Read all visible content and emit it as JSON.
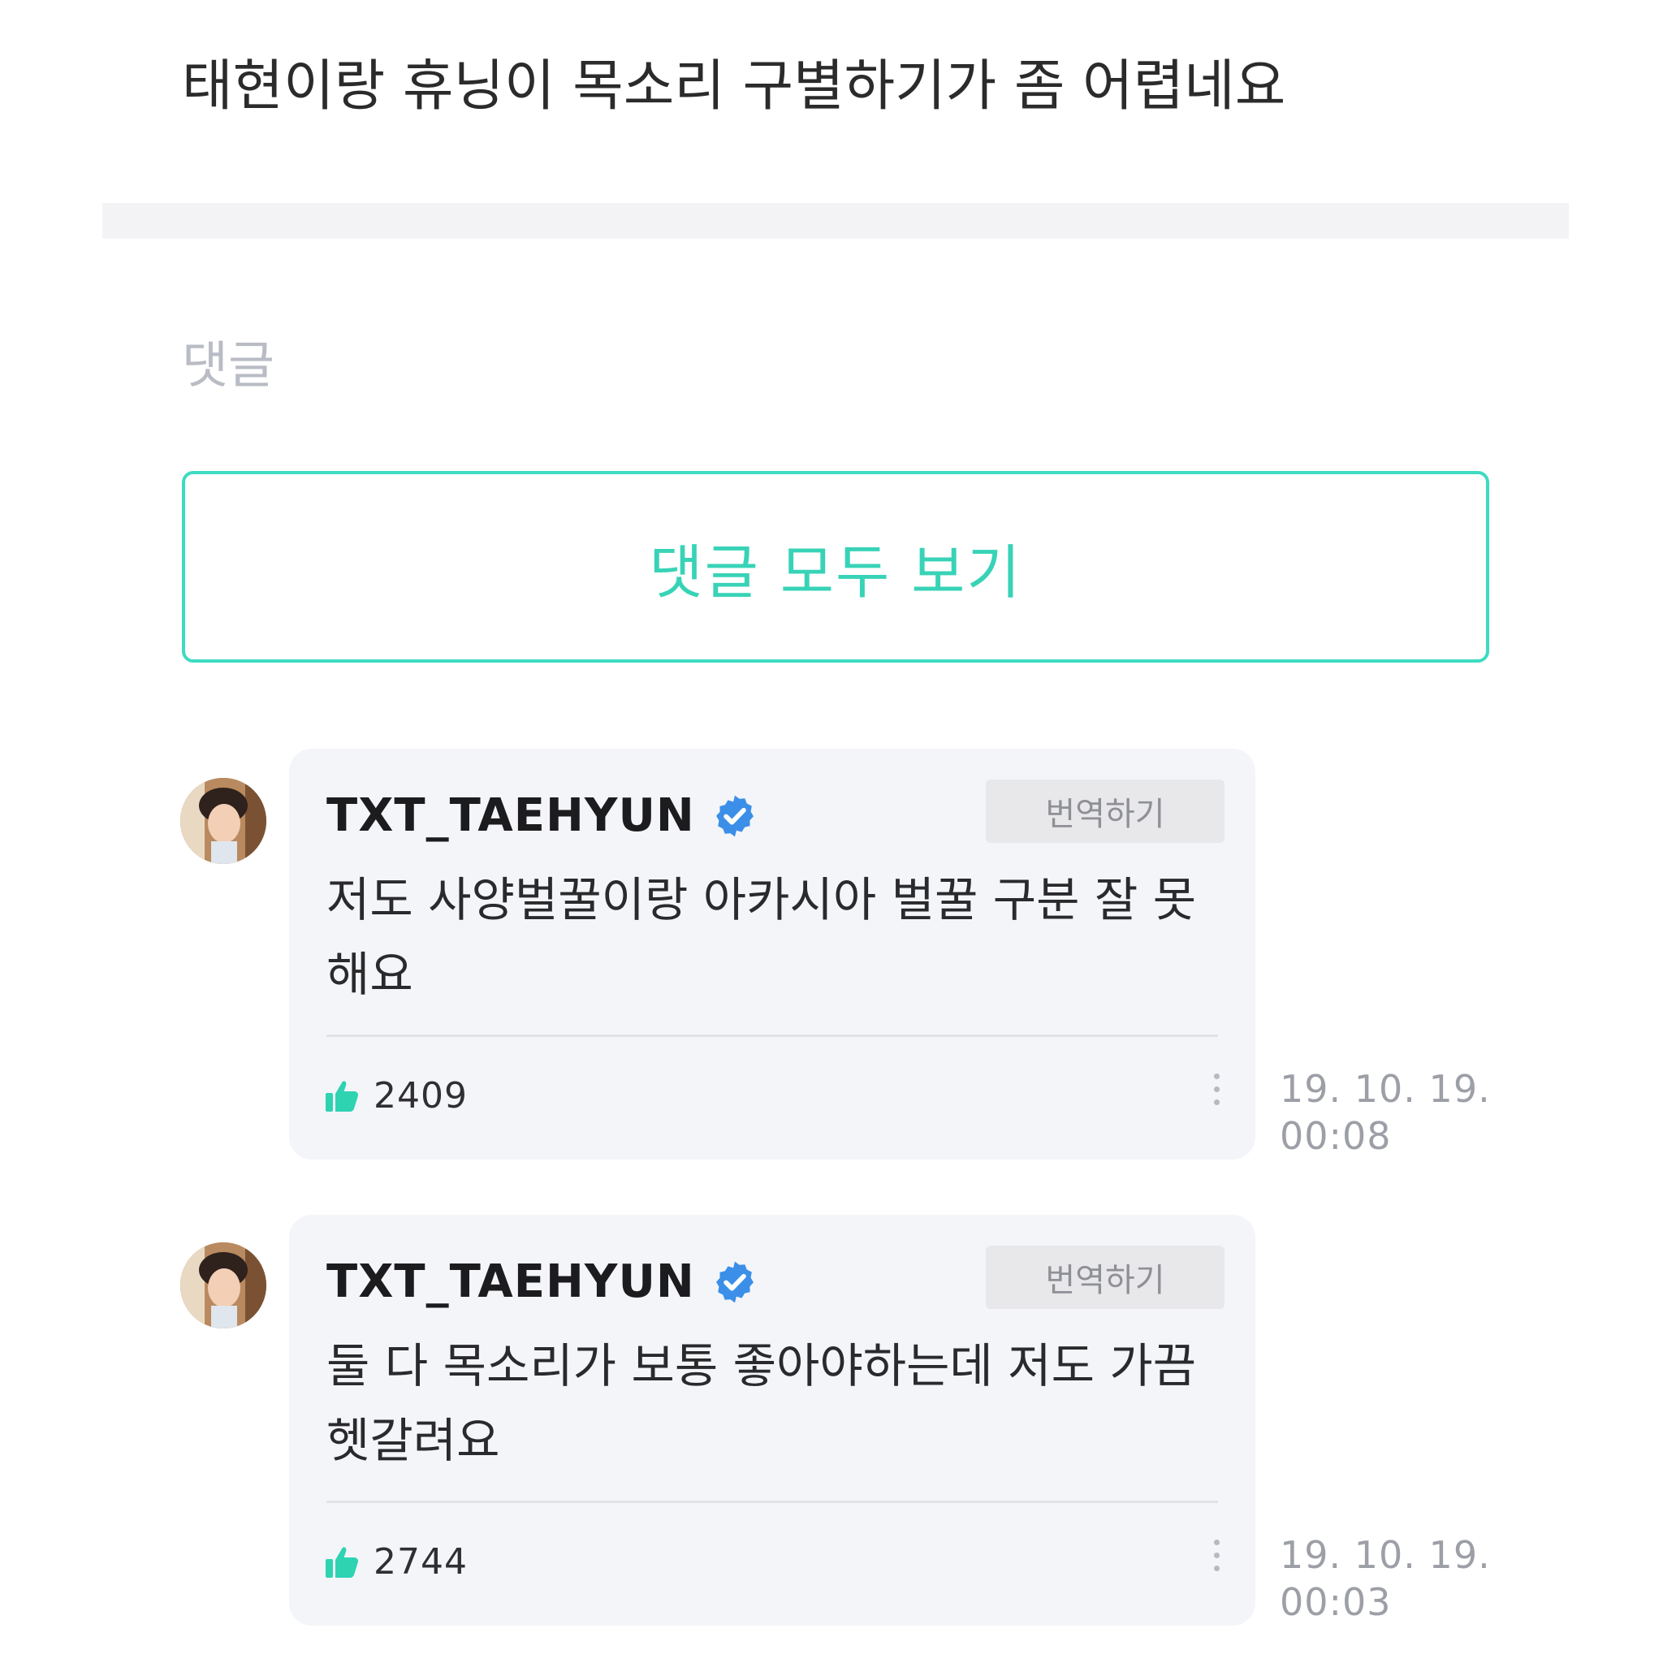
{
  "post": {
    "text": "태현이랑 휴닝이 목소리 구별하기가 좀 어렵네요"
  },
  "comments_section": {
    "title": "댓글",
    "view_all_label": "댓글 모두 보기"
  },
  "comments": [
    {
      "author": "TXT_TAEHYUN",
      "verified": true,
      "translate_label": "번역하기",
      "body": "저도 사양벌꿀이랑 아카시아 벌꿀 구분 잘 못해요",
      "likes": "2409",
      "date": "19. 10. 19.",
      "time": "00:08"
    },
    {
      "author": "TXT_TAEHYUN",
      "verified": true,
      "translate_label": "번역하기",
      "body": "둘 다 목소리가 보통 좋아야하는데 저도 가끔 헷갈려요",
      "likes": "2744",
      "date": "19. 10. 19.",
      "time": "00:03"
    }
  ],
  "colors": {
    "accent": "#3ddbc1",
    "verified": "#3b8fe8",
    "like": "#2ed3b2",
    "card_bg": "#f4f5f9"
  },
  "icons": {
    "verified": "verified-badge-icon",
    "like": "thumbs-up-icon",
    "more": "more-vertical-icon"
  }
}
